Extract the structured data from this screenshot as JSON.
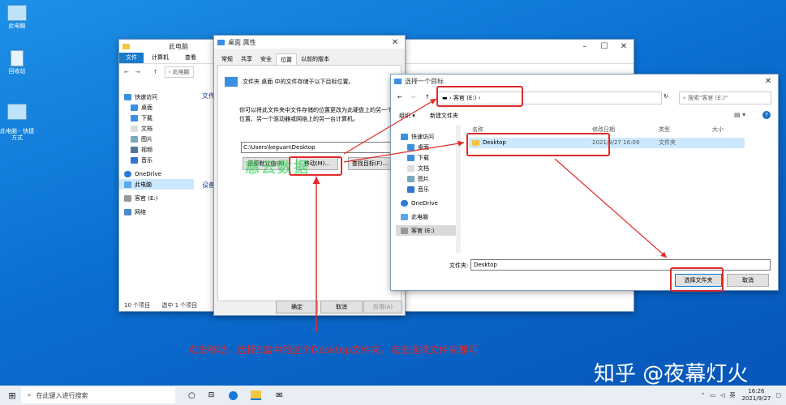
{
  "desktop": {
    "icons": [
      {
        "label": "此电脑"
      },
      {
        "label": "回收站"
      },
      {
        "label": "此电脑 - 快捷\n方式"
      }
    ],
    "annotation": "点击移动，选择E盘中的这个Desktop文件夹，点击选择文件夹即可",
    "watermark": "知乎 @夜幕灯火",
    "overlay_watermark": "慈云数据"
  },
  "explorer": {
    "title": "此电脑",
    "ribbon_tabs": [
      "文件",
      "计算机",
      "查看"
    ],
    "address": "此电脑",
    "nav": [
      "快速访问",
      "桌面",
      "下载",
      "文档",
      "图片",
      "视频",
      "音乐",
      "OneDrive",
      "此电脑",
      "客官 (E:)",
      "网络"
    ],
    "section_folders": "文件",
    "section_devices": "设备",
    "status_items": "10 个项目",
    "status_selected": "选中 1 个项目"
  },
  "properties": {
    "title": "桌面 属性",
    "tabs": [
      "常规",
      "共享",
      "安全",
      "位置",
      "以前的版本"
    ],
    "active_tab": "位置",
    "desc1": "文件夹 桌面 中的文件存储于以下目标位置。",
    "desc2": "你可以将此文件夹中文件存储的位置更改为此硬盘上的另一个位置、另一个驱动器或网络上的另一台计算机。",
    "path": "C:\\Users\\keguan\\Desktop",
    "restore_btn": "还原默认值(R)",
    "move_btn": "移动(M)...",
    "find_btn": "查找目标(F)...",
    "ok": "确定",
    "cancel": "取消",
    "apply": "应用(A)"
  },
  "picker": {
    "title": "选择一个目标",
    "breadcrumb": "客官 (E:)",
    "search_placeholder": "搜索\"客官 (E:)\"",
    "organize": "组织 ▾",
    "new_folder": "新建文件夹",
    "columns": {
      "name": "名称",
      "date": "修改日期",
      "type": "类型",
      "size": "大小"
    },
    "rows": [
      {
        "name": "Desktop",
        "date": "2021/9/27 16:09",
        "type": "文件夹",
        "size": ""
      }
    ],
    "nav": [
      "快速访问",
      "桌面",
      "下载",
      "文档",
      "图片",
      "音乐",
      "OneDrive",
      "此电脑",
      "客官 (E:)"
    ],
    "folder_label": "文件夹:",
    "folder_value": "Desktop",
    "select_btn": "选择文件夹",
    "cancel_btn": "取消"
  },
  "taskbar": {
    "search_placeholder": "在此键入进行搜索",
    "time": "16:26",
    "date": "2021/9/27",
    "ime": "英"
  },
  "colors": {
    "accent": "#0078d7",
    "annotation": "#e02a2a",
    "highlight": "#cce8ff"
  }
}
